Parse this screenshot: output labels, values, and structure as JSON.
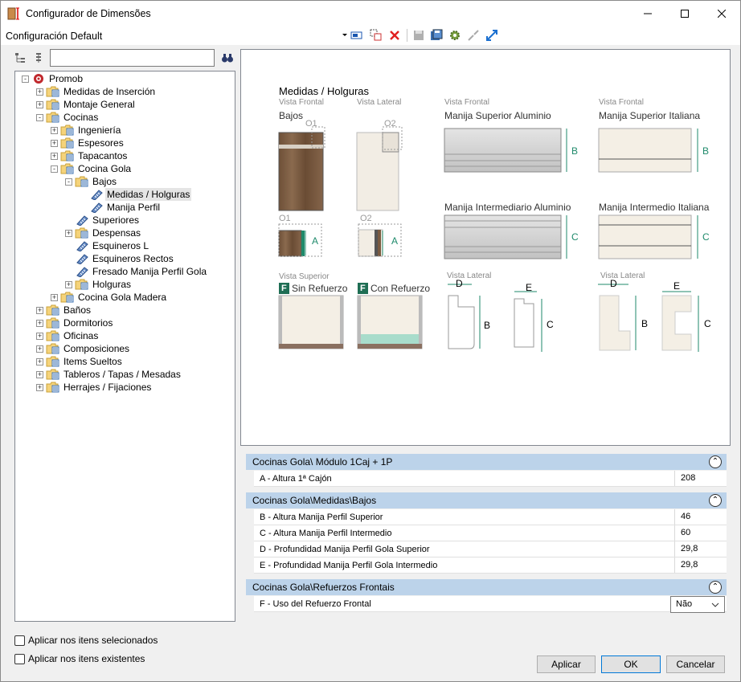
{
  "window": {
    "title": "Configurador de Dimensões"
  },
  "config": {
    "name": "Configuración Default"
  },
  "search": {
    "value": ""
  },
  "tree": [
    {
      "label": "Promob",
      "level": 0,
      "expander": "-",
      "type": "root"
    },
    {
      "label": "Medidas de Inserción",
      "level": 1,
      "expander": "+",
      "type": "folder"
    },
    {
      "label": "Montaje General",
      "level": 1,
      "expander": "+",
      "type": "folder"
    },
    {
      "label": "Cocinas",
      "level": 1,
      "expander": "-",
      "type": "folder"
    },
    {
      "label": "Ingeniería",
      "level": 2,
      "expander": "+",
      "type": "folder"
    },
    {
      "label": "Espesores",
      "level": 2,
      "expander": "+",
      "type": "folder"
    },
    {
      "label": "Tapacantos",
      "level": 2,
      "expander": "+",
      "type": "folder"
    },
    {
      "label": "Cocina Gola",
      "level": 2,
      "expander": "-",
      "type": "folder"
    },
    {
      "label": "Bajos",
      "level": 3,
      "expander": "-",
      "type": "folder"
    },
    {
      "label": "Medidas / Holguras",
      "level": 4,
      "expander": "",
      "type": "item",
      "selected": true
    },
    {
      "label": "Manija Perfil",
      "level": 4,
      "expander": "",
      "type": "item"
    },
    {
      "label": "Superiores",
      "level": 3,
      "expander": "",
      "type": "item"
    },
    {
      "label": "Despensas",
      "level": 3,
      "expander": "+",
      "type": "folder"
    },
    {
      "label": "Esquineros L",
      "level": 3,
      "expander": "",
      "type": "item"
    },
    {
      "label": "Esquineros Rectos",
      "level": 3,
      "expander": "",
      "type": "item"
    },
    {
      "label": "Fresado Manija Perfil Gola",
      "level": 3,
      "expander": "",
      "type": "item"
    },
    {
      "label": "Holguras",
      "level": 3,
      "expander": "+",
      "type": "folder"
    },
    {
      "label": "Cocina Gola Madera",
      "level": 2,
      "expander": "+",
      "type": "folder"
    },
    {
      "label": "Baños",
      "level": 1,
      "expander": "+",
      "type": "folder"
    },
    {
      "label": "Dormitorios",
      "level": 1,
      "expander": "+",
      "type": "folder"
    },
    {
      "label": "Oficinas",
      "level": 1,
      "expander": "+",
      "type": "folder"
    },
    {
      "label": "Composiciones",
      "level": 1,
      "expander": "+",
      "type": "folder"
    },
    {
      "label": "Items Sueltos",
      "level": 1,
      "expander": "+",
      "type": "folder"
    },
    {
      "label": "Tableros / Tapas / Mesadas",
      "level": 1,
      "expander": "+",
      "type": "folder"
    },
    {
      "label": "Herrajes / Fijaciones",
      "level": 1,
      "expander": "+",
      "type": "folder"
    }
  ],
  "preview": {
    "heading": "Medidas / Holguras",
    "vista_frontal": "Vista Frontal",
    "vista_lateral": "Vista Lateral",
    "vista_superior": "Vista Superior",
    "bajos": "Bajos",
    "o1": "O1",
    "o2": "O2",
    "manija_sup_al": "Manija Superior Aluminio",
    "manija_sup_it": "Manija Superior Italiana",
    "manija_int_al": "Manija Intermediario Aluminio",
    "manija_int_it": "Manija Intermedio Italiana",
    "f": "F",
    "sin_refuerzo": "Sin Refuerzo",
    "con_refuerzo": "Con Refuerzo",
    "a": "A",
    "b": "B",
    "c": "C",
    "d": "D",
    "e": "E"
  },
  "groups": [
    {
      "title": "Cocinas Gola\\ Módulo 1Caj + 1P",
      "rows": [
        {
          "name": "A - Altura 1ª Cajón",
          "value": "208"
        }
      ]
    },
    {
      "title": "Cocinas Gola\\Medidas\\Bajos",
      "rows": [
        {
          "name": "B - Altura Manija Perfil Superior",
          "value": "46"
        },
        {
          "name": "C - Altura Manija Perfil Intermedio",
          "value": "60"
        },
        {
          "name": "D - Profundidad Manija Perfil Gola Superior",
          "value": "29,8"
        },
        {
          "name": "E - Profundidad Manija Perfil Gola Intermedio",
          "value": "29,8"
        }
      ]
    },
    {
      "title": "Cocinas Gola\\Refuerzos Frontais",
      "rows": [
        {
          "name": "F - Uso del Refuerzo Frontal",
          "value": "Não"
        }
      ]
    }
  ],
  "checks": {
    "selected": "Aplicar nos itens selecionados",
    "existing": "Aplicar nos itens existentes"
  },
  "buttons": {
    "apply": "Aplicar",
    "ok": "OK",
    "cancel": "Cancelar"
  },
  "colors": {
    "accent": "#1f8a6b",
    "header": "#bcd3ea",
    "wood": "#7a5a40",
    "close": "#e81123"
  }
}
